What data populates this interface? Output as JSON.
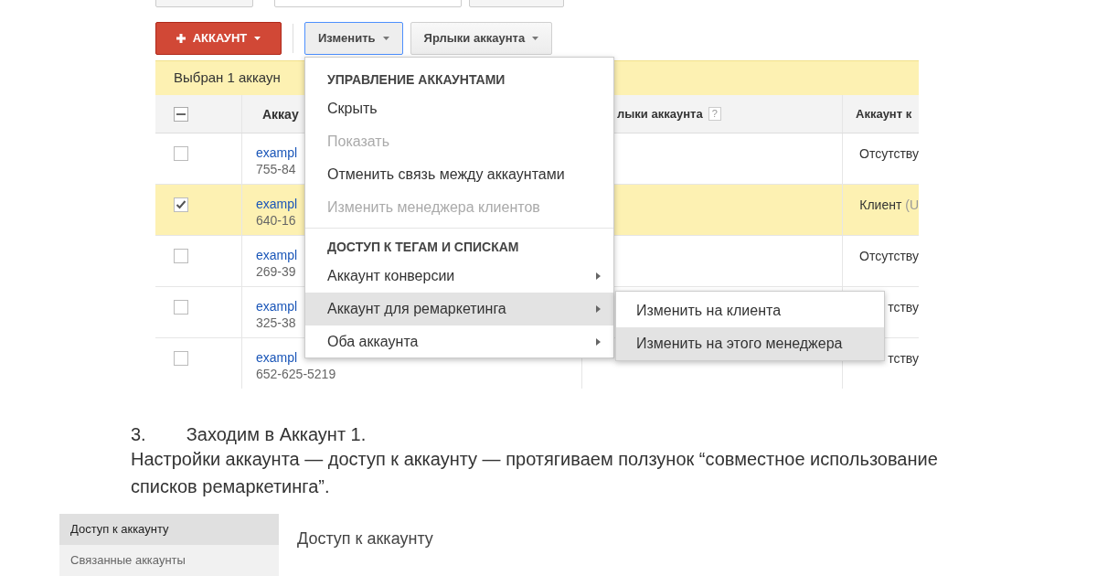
{
  "screenshot_1": {
    "top_controls": [
      {
        "kind": "button"
      },
      {
        "kind": "field"
      },
      {
        "kind": "button"
      }
    ],
    "toolbar": [
      {
        "label": "АККАУНТ",
        "kind": "add",
        "expanded": false
      },
      {
        "label": "Изменить",
        "kind": "menu",
        "expanded": true
      },
      {
        "label": "Ярлыки аккаунта",
        "kind": "menu",
        "expanded": false
      }
    ],
    "selection_bar": "Выбран 1 аккаун",
    "table": {
      "header_checkbox": {
        "mixed": true
      },
      "columns": [
        {
          "label": "Аккау"
        },
        {
          "label": "лыки аккаунта",
          "help_text": "?"
        },
        {
          "label": "Аккаунт к"
        }
      ],
      "rows": [
        {
          "selected": false,
          "checked": false,
          "account": "exampl",
          "id": "755-84",
          "type": "Отсутству"
        },
        {
          "selected": true,
          "checked": true,
          "account": "exampl",
          "id": "640-16",
          "type": "Клиент",
          "type_note": "(U"
        },
        {
          "selected": false,
          "checked": false,
          "account": "exampl",
          "id": "269-39",
          "type": "Отсутству"
        },
        {
          "selected": false,
          "checked": false,
          "account": "exampl",
          "id": "325-38",
          "type": "тству"
        },
        {
          "selected": false,
          "checked": false,
          "account": "exampl",
          "id": "652-625-5219",
          "type": "тству"
        }
      ]
    },
    "menu": {
      "sections": [
        {
          "heading": "УПРАВЛЕНИЕ АККАУНТАМИ",
          "items": [
            {
              "label": "Скрыть",
              "disabled": false,
              "submenu": false,
              "selected": false
            },
            {
              "label": "Показать",
              "disabled": true,
              "submenu": false,
              "selected": false
            },
            {
              "label": "Отменить связь между аккаунтами",
              "disabled": false,
              "submenu": false,
              "selected": false
            },
            {
              "label": "Изменить менеджера клиентов",
              "disabled": true,
              "submenu": false,
              "selected": false
            }
          ]
        },
        {
          "heading": "ДОСТУП К ТЕГАМ И СПИСКАМ",
          "items": [
            {
              "label": "Аккаунт конверсии",
              "disabled": false,
              "submenu": true,
              "selected": false
            },
            {
              "label": "Аккаунт для ремаркетинга",
              "disabled": false,
              "submenu": true,
              "selected": true
            },
            {
              "label": "Оба аккаунта",
              "disabled": false,
              "submenu": true,
              "selected": false
            }
          ]
        }
      ],
      "submenu": [
        {
          "label": "Изменить на клиента",
          "selected": false
        },
        {
          "label": "Изменить на этого менеджера",
          "selected": true
        }
      ]
    }
  },
  "step": {
    "number": "3.",
    "text": "Заходим в Аккаунт 1."
  },
  "paragraph": "Настройки аккаунта — доступ к аккаунту — протягиваем ползунок “совместное использование списков ремаркетинга”.",
  "screenshot_2": {
    "sidebar": [
      {
        "label": "Доступ к аккаунту",
        "selected": true
      },
      {
        "label": "Связанные аккаунты",
        "selected": false
      }
    ],
    "title": "Доступ к аккаунту"
  }
}
